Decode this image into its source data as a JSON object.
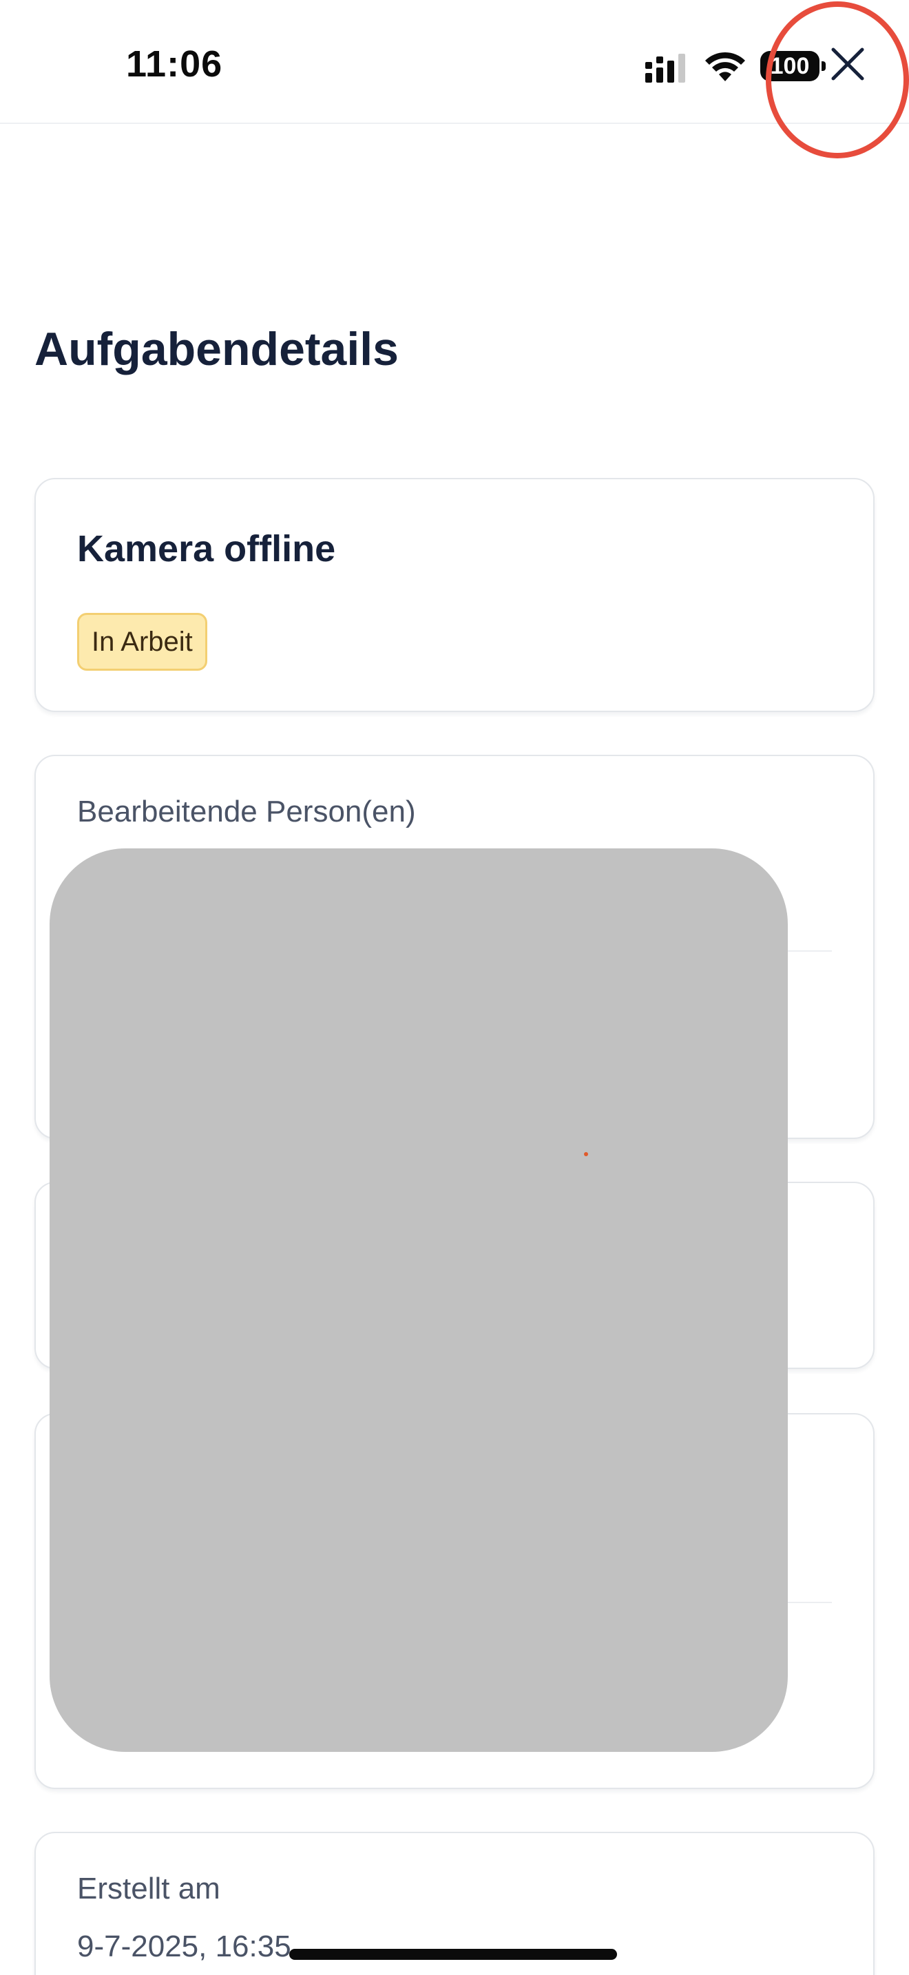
{
  "status_bar": {
    "time": "11:06",
    "battery": "100",
    "icons": [
      "signal-icon",
      "wifi-icon",
      "battery-icon"
    ]
  },
  "header": {
    "close_icon": "close-icon",
    "close_symbol": "✕"
  },
  "page": {
    "title": "Aufgabendetails"
  },
  "task": {
    "title": "Kamera offline",
    "status": "In Arbeit"
  },
  "assignees": {
    "label": "Bearbeitende Person(en)"
  },
  "created": {
    "label": "Erstellt am",
    "value": "9-7-2025, 16:35"
  },
  "colors": {
    "accent_text": "#16213a",
    "badge_bg": "#fdeaae",
    "badge_border": "#f3cf72",
    "highlight": "#e74c3c",
    "redaction": "#c1c1c1"
  }
}
